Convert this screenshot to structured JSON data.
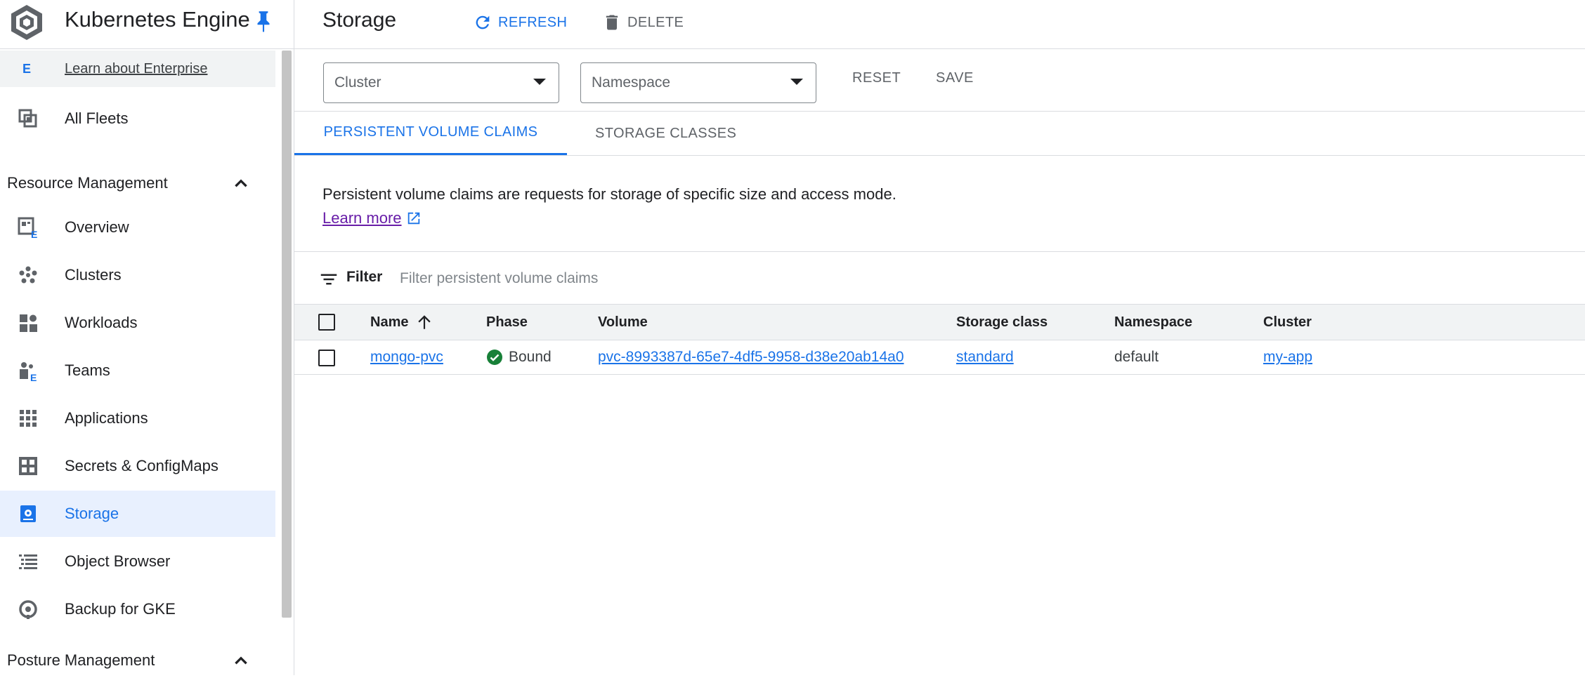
{
  "app": {
    "product_title": "Kubernetes Engine"
  },
  "sidebar": {
    "enterprise_link": "Learn about Enterprise",
    "enterprise_badge": "E",
    "all_fleets": "All Fleets",
    "sections": [
      {
        "label": "Resource Management",
        "expanded": true
      },
      {
        "label": "Posture Management",
        "expanded": true
      }
    ],
    "items": [
      {
        "label": "Overview",
        "icon": "overview-icon"
      },
      {
        "label": "Clusters",
        "icon": "clusters-icon"
      },
      {
        "label": "Workloads",
        "icon": "workloads-icon"
      },
      {
        "label": "Teams",
        "icon": "teams-icon"
      },
      {
        "label": "Applications",
        "icon": "applications-icon"
      },
      {
        "label": "Secrets & ConfigMaps",
        "icon": "secrets-icon"
      },
      {
        "label": "Storage",
        "icon": "storage-icon",
        "active": true
      },
      {
        "label": "Object Browser",
        "icon": "object-browser-icon"
      },
      {
        "label": "Backup for GKE",
        "icon": "backup-icon"
      }
    ]
  },
  "header": {
    "page_title": "Storage",
    "refresh_label": "REFRESH",
    "delete_label": "DELETE"
  },
  "filters": {
    "cluster_placeholder": "Cluster",
    "namespace_placeholder": "Namespace",
    "reset_label": "RESET",
    "save_label": "SAVE"
  },
  "tabs": [
    {
      "label": "PERSISTENT VOLUME CLAIMS",
      "active": true
    },
    {
      "label": "STORAGE CLASSES",
      "active": false
    }
  ],
  "description": {
    "text": "Persistent volume claims are requests for storage of specific size and access mode.",
    "learn_more": "Learn more"
  },
  "filter_bar": {
    "label": "Filter",
    "placeholder": "Filter persistent volume claims"
  },
  "table": {
    "columns": [
      "Name",
      "Phase",
      "Volume",
      "Storage class",
      "Namespace",
      "Cluster"
    ],
    "sort": {
      "column": "Name",
      "direction": "ascending"
    },
    "rows": [
      {
        "name": "mongo-pvc",
        "phase": "Bound",
        "volume": "pvc-8993387d-65e7-4df5-9958-d38e20ab14a0",
        "storage_class": "standard",
        "namespace": "default",
        "cluster": "my-app"
      }
    ]
  },
  "colors": {
    "accent": "#1a73e8",
    "active_bg": "#e8f0fe",
    "success": "#188038",
    "visited_link": "#681da8"
  }
}
